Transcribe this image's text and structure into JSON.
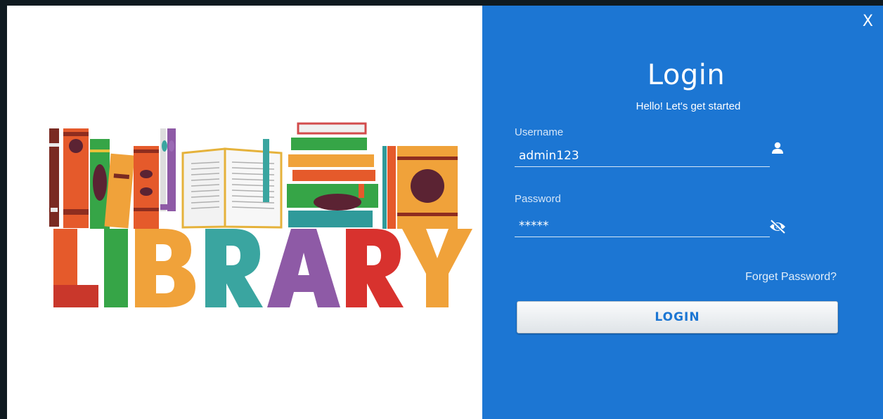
{
  "window": {
    "close_label": "X"
  },
  "brand": {
    "logo_text": "LIBRARY"
  },
  "login": {
    "title": "Login",
    "subtitle": "Hello! Let's get started",
    "username_label": "Username",
    "username_value": "admin123",
    "password_label": "Password",
    "password_value": "*****",
    "forgot_label": "Forget Password?",
    "login_button_label": "LOGIN"
  },
  "icons": {
    "username_icon": "user-icon",
    "password_icon": "eye-slash-icon"
  },
  "colors": {
    "panel_blue": "#1c76d3",
    "button_text": "#1c76d3"
  }
}
